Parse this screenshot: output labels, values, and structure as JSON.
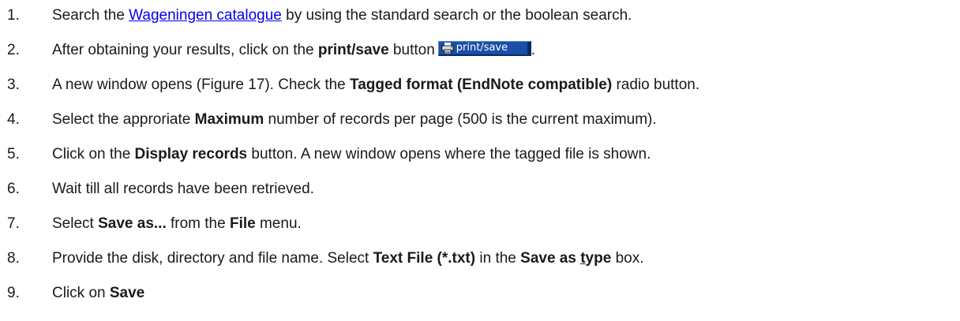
{
  "steps": [
    {
      "number": "1.",
      "before": "Search the ",
      "link": "Wageningen catalogue",
      "after": " by using the standard search or the boolean search."
    },
    {
      "number": "2.",
      "before": "After obtaining your results, click on the ",
      "bold": "print/save",
      "after": " button",
      "button_label": "print/save",
      "end": "."
    },
    {
      "number": "3.",
      "before": "A new window opens (Figure 17). Check the ",
      "bold": "Tagged format (EndNote compatible)",
      "after": " radio button."
    },
    {
      "number": "4.",
      "before": "Select the approriate ",
      "bold": "Maximum",
      "after": " number of records per page (500 is the current maximum)."
    },
    {
      "number": "5.",
      "before": "Click on the ",
      "bold": "Display records",
      "after": " button. A new window opens where the tagged file is shown."
    },
    {
      "number": "6.",
      "text": "Wait till all records have been retrieved."
    },
    {
      "number": "7.",
      "before": "Select ",
      "bold": "Save as...",
      "middle": " from the ",
      "bold2": "File",
      "after": " menu."
    },
    {
      "number": "8.",
      "before": "Provide the disk, directory and file name. Select ",
      "bold": "Text File (*.txt)",
      "middle": " in the ",
      "bold2a": "Save as ",
      "bold2u": "t",
      "bold2b": "ype",
      "after": " box."
    },
    {
      "number": "9.",
      "before": "Click on ",
      "bold": "Save"
    }
  ],
  "icons": {
    "print_button_icon": "printer-icon"
  },
  "colors": {
    "link": "#0000ee",
    "button_bg": "#1a4fa8",
    "button_text": "#ffffff"
  }
}
